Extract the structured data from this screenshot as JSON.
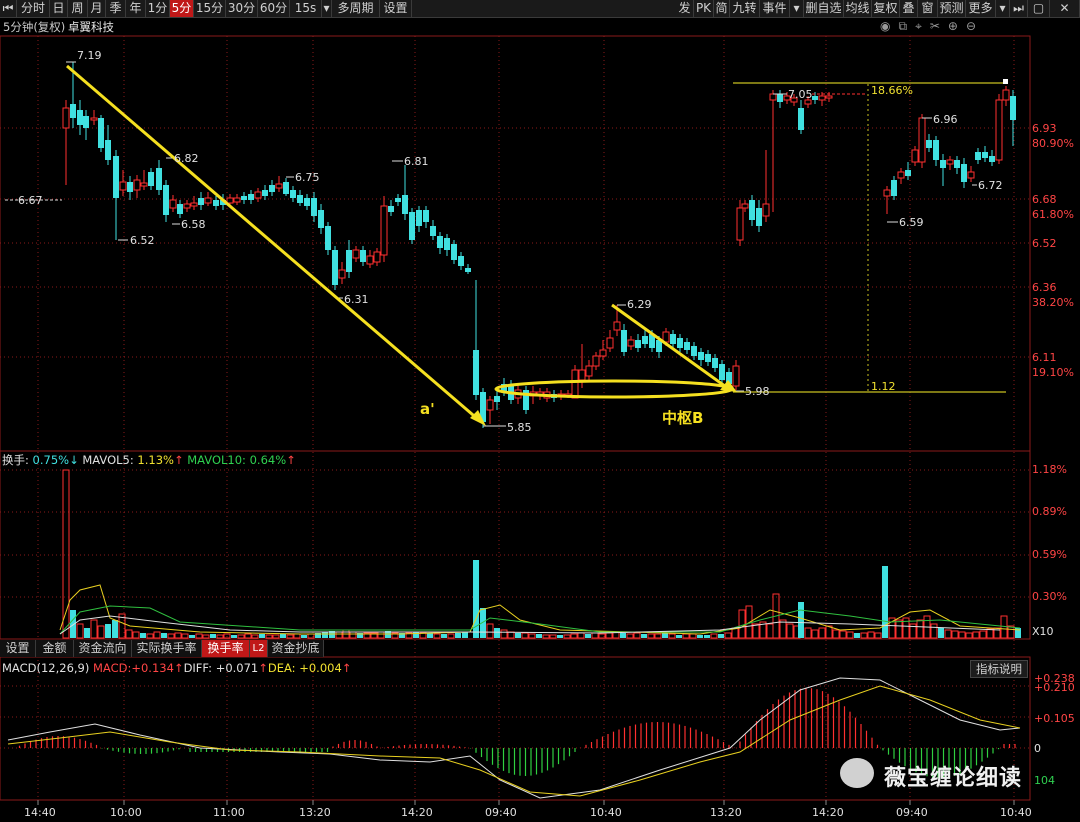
{
  "toolbar": {
    "periods": [
      "分时",
      "日",
      "周",
      "月",
      "季",
      "年",
      "1分",
      "5分",
      "15分",
      "30分",
      "60分",
      "15s",
      "多周期",
      "设置"
    ],
    "active_period": "5分",
    "right_items": [
      "发",
      "PK",
      "简",
      "九转",
      "事件",
      "删自选",
      "均线",
      "复权",
      "叠",
      "窗",
      "预测",
      "更多"
    ]
  },
  "title": {
    "period_label": "5分钟(复权)",
    "stock_name": "卓翼科技"
  },
  "price_axis": {
    "ticks": [
      {
        "price": "6.93",
        "pct": "80.90%"
      },
      {
        "price": "6.68",
        "pct": "61.80%"
      },
      {
        "price": "6.52",
        "pct": ""
      },
      {
        "price": "6.36",
        "pct": "38.20%"
      },
      {
        "price": "6.11",
        "pct": "19.10%"
      }
    ]
  },
  "annotations": {
    "left_price": "6.67",
    "labels": [
      "7.19",
      "6.82",
      "6.52",
      "6.58",
      "6.75",
      "6.31",
      "6.81",
      "5.85",
      "6.29",
      "5.98",
      "7.05",
      "6.96",
      "6.72",
      "6.59"
    ],
    "fib_top": "18.66%",
    "fib_bottom": "1.12",
    "a_prime": "a'",
    "hub": "中枢B"
  },
  "volume": {
    "title": "换手:",
    "value": "0.75%",
    "mavol5_label": "MAVOL5:",
    "mavol5": "1.13%",
    "mavol10_label": "MAVOL10:",
    "mavol10": "0.64%",
    "ticks": [
      "1.18%",
      "0.89%",
      "0.59%",
      "0.30%"
    ],
    "multiplier": "X10"
  },
  "tabs": [
    "设置",
    "金额",
    "资金流向",
    "实际换手率",
    "换手率",
    "L2",
    "资金抄底"
  ],
  "active_tab": "换手率",
  "macd": {
    "name": "MACD(12,26,9)",
    "macd_label": "MACD:",
    "macd_value": "+0.134",
    "diff_label": "DIFF:",
    "diff_value": "+0.071",
    "dea_label": "DEA:",
    "dea_value": "+0.004",
    "help_button": "指标说明",
    "ticks": [
      "+0.238",
      "+0.210",
      "+0.105",
      "0"
    ],
    "neg_tick": "104"
  },
  "time_axis": [
    "14:40",
    "10:00",
    "11:00",
    "13:20",
    "14:20",
    "09:40",
    "10:40",
    "13:20",
    "14:20",
    "09:40",
    "10:40"
  ],
  "watermark": "薇宝缠论细读",
  "colors": {
    "up": "#ff3030",
    "down": "#40e0e0",
    "accent_yellow": "#f5e020",
    "grid": "#8a1a1a"
  }
}
